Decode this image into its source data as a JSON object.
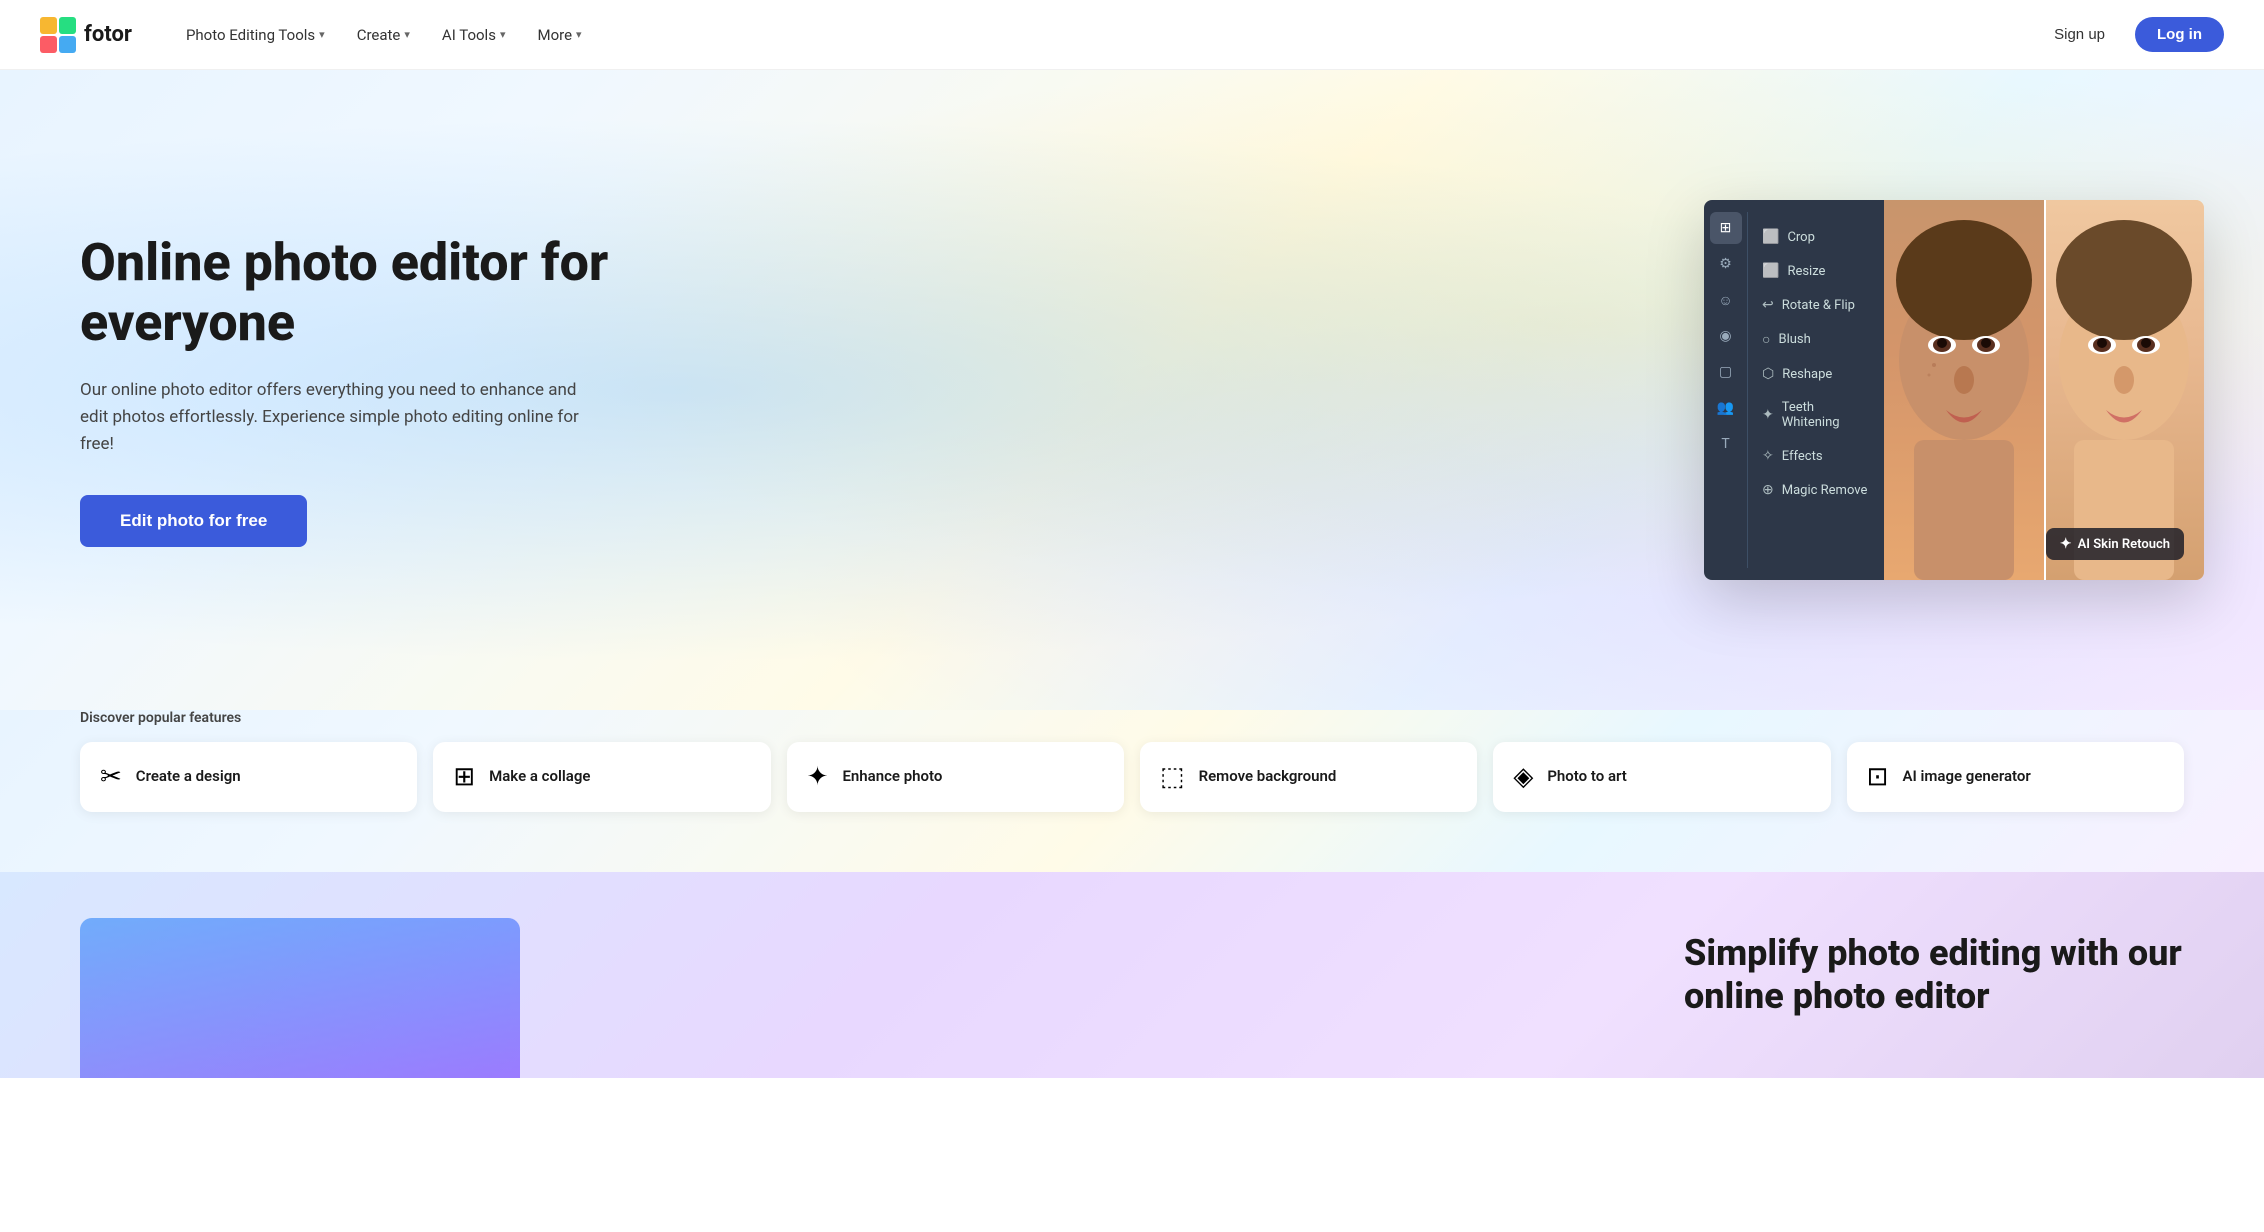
{
  "brand": {
    "name": "fotor",
    "logo_unicode": "🟥"
  },
  "nav": {
    "items": [
      {
        "label": "Photo Editing Tools",
        "has_dropdown": true
      },
      {
        "label": "Create",
        "has_dropdown": true
      },
      {
        "label": "AI Tools",
        "has_dropdown": true
      },
      {
        "label": "More",
        "has_dropdown": true
      }
    ],
    "actions": {
      "signup": "Sign up",
      "login": "Log in"
    }
  },
  "hero": {
    "title": "Online photo editor for everyone",
    "description": "Our online photo editor offers everything you need to enhance and edit photos effortlessly. Experience simple photo editing online for free!",
    "cta": "Edit photo for free"
  },
  "editor_panel": {
    "menu_items": [
      {
        "icon": "⬜",
        "label": "Crop"
      },
      {
        "icon": "⬜",
        "label": "Resize"
      },
      {
        "icon": "↩",
        "label": "Rotate & Flip"
      },
      {
        "icon": "○",
        "label": "Blush"
      },
      {
        "icon": "⬡",
        "label": "Reshape"
      },
      {
        "icon": "✦",
        "label": "Teeth Whitening"
      },
      {
        "icon": "✧",
        "label": "Effects"
      },
      {
        "icon": "⊕",
        "label": "Magic Remove"
      }
    ],
    "ai_badge": "AI Skin Retouch"
  },
  "discover": {
    "label": "Discover popular features",
    "features": [
      {
        "icon": "✂",
        "label": "Create a design"
      },
      {
        "icon": "⊞",
        "label": "Make a collage"
      },
      {
        "icon": "✦",
        "label": "Enhance photo"
      },
      {
        "icon": "⬚",
        "label": "Remove background"
      },
      {
        "icon": "◈",
        "label": "Photo to art"
      },
      {
        "icon": "⊡",
        "label": "AI image generator"
      }
    ]
  },
  "bottom": {
    "title": "Simplify photo editing with our online photo editor"
  }
}
